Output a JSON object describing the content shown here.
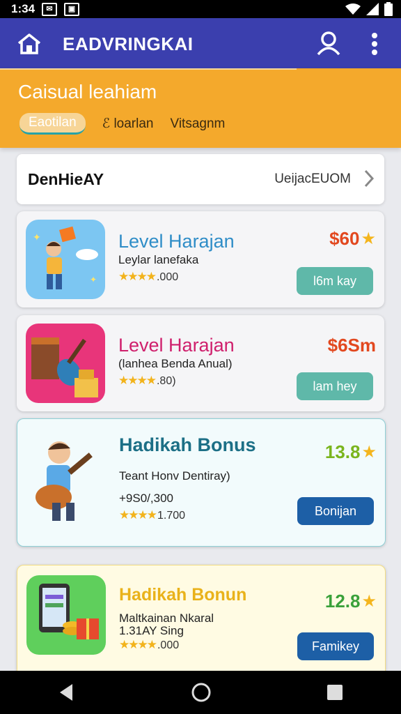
{
  "status": {
    "time": "1:34",
    "icon1": "✉",
    "icon2": "▣"
  },
  "appbar": {
    "title": "EADVRINGKAI",
    "home_icon": "home-icon",
    "user_icon": "user-icon",
    "more_icon": "more-vert-icon"
  },
  "banner": {
    "title": "Caisual leahiam",
    "tabs": [
      {
        "label": "Eaotilan"
      },
      {
        "label": "ℰ loarlan"
      },
      {
        "label": "Vitsagnm"
      }
    ]
  },
  "section": {
    "left": "DenHieAY",
    "right": "UeijacEUOM"
  },
  "cards": [
    {
      "title": "Level Harajan",
      "subtitle": "Leylar lanefaka",
      "rating": "★★★★",
      "rating_text": ".000",
      "price": "$60",
      "button": "l6m kay",
      "title_color": "#2f8dc7",
      "price_color": "#e2481f",
      "button_color": "#5fb8a9"
    },
    {
      "title": "Level Harajan",
      "subtitle": "(lanhea Benda Anual)",
      "rating": "★★★★",
      "rating_text": ".80)",
      "price": "$6Sm",
      "button": "lam hey",
      "title_color": "#cf1f6c",
      "price_color": "#e2481f",
      "button_color": "#5fb8a9"
    },
    {
      "title": "Hadikah Bonus",
      "subtitle": "Teant Honv Dentiray)",
      "extra": "+9S0/,300",
      "rating": "★★★★",
      "rating_text": "1.700",
      "price": "13.8",
      "button": "Bonijan",
      "title_color": "#1c6f86",
      "price_color": "#7ab51d",
      "button_color": "#1d5fa6"
    },
    {
      "title": "Hadikah Bonun",
      "subtitle": "Maltkainan Nkaral",
      "extra": "1.31AY Sing",
      "rating": "★★★★",
      "rating_text": ".000",
      "price": "12.8",
      "button": "Famikey",
      "title_color": "#e9b21a",
      "price_color": "#3aa13a",
      "button_color": "#1d5fa6"
    }
  ]
}
